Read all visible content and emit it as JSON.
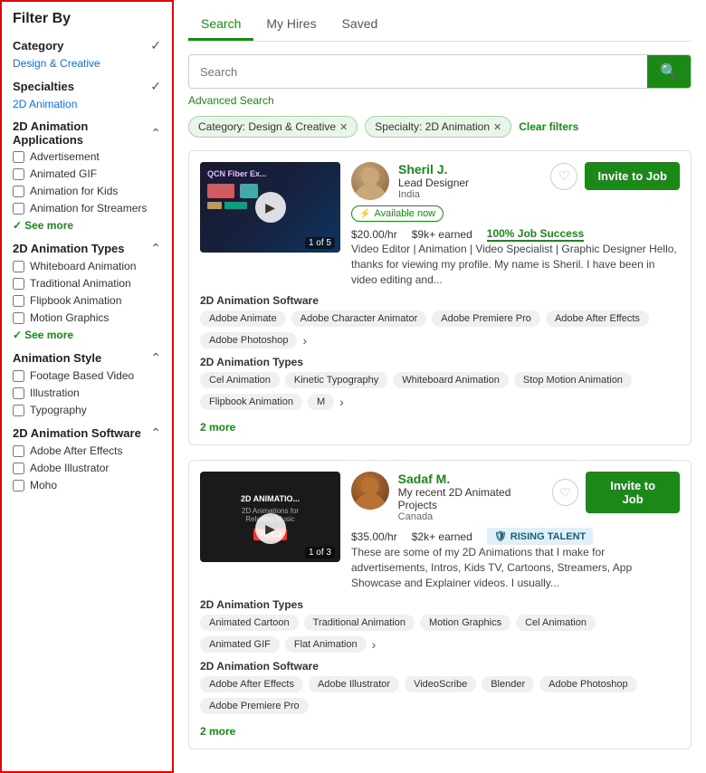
{
  "sidebar": {
    "title": "Filter By",
    "sections": [
      {
        "id": "category",
        "label": "Category",
        "expanded": false,
        "selected_value": "Design & Creative"
      },
      {
        "id": "specialties",
        "label": "Specialties",
        "expanded": false,
        "selected_value": "2D Animation"
      },
      {
        "id": "2d_animation_applications",
        "label": "2D Animation Applications",
        "expanded": true,
        "items": [
          "Advertisement",
          "Animated GIF",
          "Animation for Kids",
          "Animation for Streamers"
        ],
        "see_more": "See more"
      },
      {
        "id": "2d_animation_types",
        "label": "2D Animation Types",
        "expanded": true,
        "items": [
          "Whiteboard Animation",
          "Traditional Animation",
          "Flipbook Animation",
          "Motion Graphics"
        ],
        "see_more": "See more"
      },
      {
        "id": "animation_style",
        "label": "Animation Style",
        "expanded": true,
        "items": [
          "Footage Based Video",
          "Illustration",
          "Typography"
        ],
        "see_more": null
      },
      {
        "id": "2d_animation_software",
        "label": "2D Animation Software",
        "expanded": true,
        "items": [
          "Adobe After Effects",
          "Adobe Illustrator",
          "Moho"
        ],
        "see_more": null
      }
    ]
  },
  "main": {
    "tabs": [
      {
        "id": "search",
        "label": "Search",
        "active": true
      },
      {
        "id": "my_hires",
        "label": "My Hires",
        "active": false
      },
      {
        "id": "saved",
        "label": "Saved",
        "active": false
      }
    ],
    "search": {
      "placeholder": "Search",
      "search_icon": "🔍"
    },
    "advanced_search": "Advanced Search",
    "filter_pills": [
      {
        "label": "Category: Design & Creative",
        "removable": true
      },
      {
        "label": "Specialty: 2D Animation",
        "removable": true
      }
    ],
    "clear_filters": "Clear filters",
    "freelancers": [
      {
        "id": "sheril",
        "video_label": "QCN Fiber Ex...",
        "slide_count": "1 of 5",
        "name": "Sheril J.",
        "title": "Lead Designer",
        "location": "India",
        "available": "Available now",
        "rate": "$20.00/hr",
        "earned": "$9k+ earned",
        "job_success": "100% Job Success",
        "description": "Video Editor | Animation | Video Specialist | Graphic Designer Hello, thanks for viewing my profile. My name is Sheril. I have been in video editing and...",
        "software_label": "2D Animation Software",
        "software_tags": [
          "Adobe Animate",
          "Adobe Character Animator",
          "Adobe Premiere Pro",
          "Adobe After Effects",
          "Adobe Photoshop"
        ],
        "types_label": "2D Animation Types",
        "types_tags": [
          "Cel Animation",
          "Kinetic Typography",
          "Whiteboard Animation",
          "Stop Motion Animation",
          "Flipbook Animation",
          "M"
        ],
        "more_count": "2 more",
        "rising_talent": false,
        "invite_label": "Invite to Job"
      },
      {
        "id": "sadaf",
        "video_label": "2D ANIMATIO...",
        "video_sublabel": "2D Animations for Relaxing Music",
        "video_tag": "VIDEO",
        "slide_count": "1 of 3",
        "name": "Sadaf M.",
        "title": "My recent 2D Animated Projects",
        "location": "Canada",
        "available": null,
        "rate": "$35.00/hr",
        "earned": "$2k+ earned",
        "job_success": null,
        "rising_talent": true,
        "rising_talent_label": "RISING TALENT",
        "description": "These are some of my 2D Animations that I make for advertisements, Intros, Kids TV, Cartoons, Streamers, App Showcase and Explainer videos. I usually...",
        "types_label": "2D Animation Types",
        "types_tags": [
          "Animated Cartoon",
          "Traditional Animation",
          "Motion Graphics",
          "Cel Animation",
          "Animated GIF",
          "Flat Animation"
        ],
        "software_label": "2D Animation Software",
        "software_tags": [
          "Adobe After Effects",
          "Adobe Illustrator",
          "VideoScribe",
          "Blender",
          "Adobe Photoshop",
          "Adobe Premiere Pro"
        ],
        "more_count": "2 more",
        "invite_label": "Invite to Job"
      }
    ]
  }
}
